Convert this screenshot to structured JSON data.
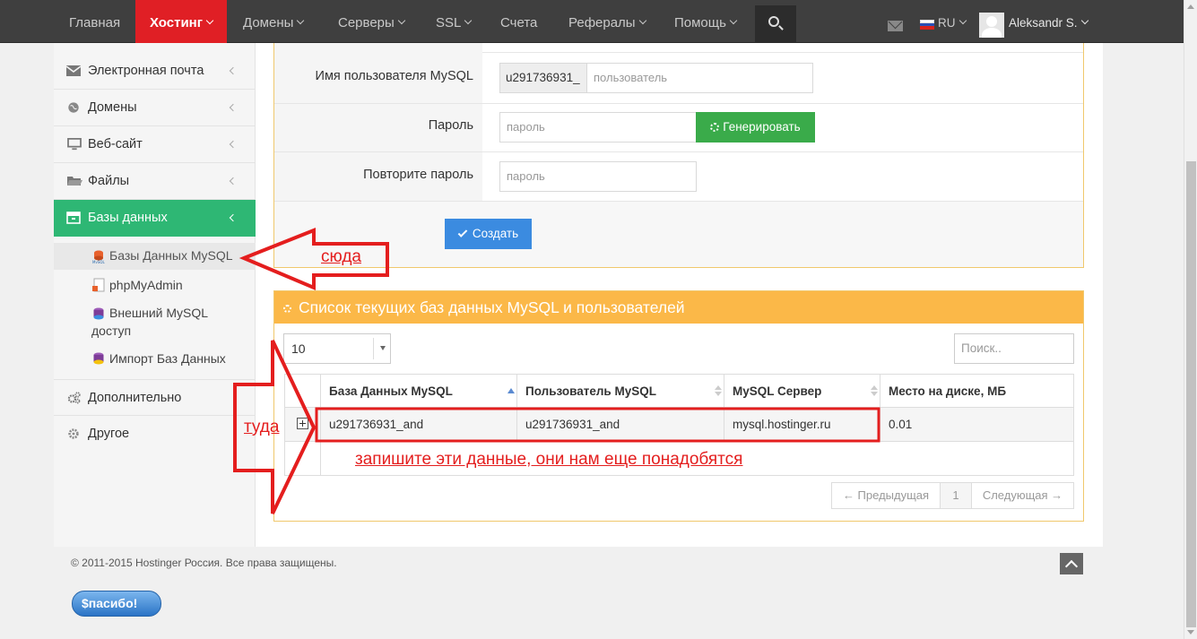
{
  "nav": {
    "items": [
      {
        "label": "Главная",
        "caret": false
      },
      {
        "label": "Хостинг",
        "caret": true
      },
      {
        "label": "Домены",
        "caret": true
      },
      {
        "label": "Серверы",
        "caret": true
      },
      {
        "label": "SSL",
        "caret": true
      },
      {
        "label": "Счета",
        "caret": false
      },
      {
        "label": "Рефералы",
        "caret": true
      },
      {
        "label": "Помощь",
        "caret": true
      }
    ],
    "active_item": "Хостинг",
    "language": "RU",
    "user_name": "Aleksandr S.",
    "accent_color": "#e01f25",
    "icons": [
      "search-icon",
      "mail-icon",
      "ru-flag-icon",
      "avatar-icon"
    ]
  },
  "sidebar": {
    "items": [
      {
        "label": "Электронная почта",
        "icon": "envelope-icon"
      },
      {
        "label": "Домены",
        "icon": "globe-icon"
      },
      {
        "label": "Веб-сайт",
        "icon": "monitor-icon"
      },
      {
        "label": "Файлы",
        "icon": "folder-icon"
      },
      {
        "label": "Базы данных",
        "icon": "database-icon"
      },
      {
        "label": "Дополнительно",
        "icon": "cogs-icon"
      },
      {
        "label": "Другое",
        "icon": "gear-icon"
      }
    ],
    "active_item": "Базы данных",
    "active_color": "#2eb774",
    "subitems": [
      {
        "label": "Базы Данных MySQL",
        "icon": "mysql-icon"
      },
      {
        "label": "phpMyAdmin",
        "icon": "phpmyadmin-icon"
      },
      {
        "label": "Внешний MySQL доступ",
        "label_line1": "Внешний MySQL",
        "label_line2": "доступ",
        "icon": "remote-db-icon"
      },
      {
        "label": "Импорт Баз Данных",
        "icon": "import-db-icon"
      }
    ],
    "active_subitem": "Базы Данных MySQL"
  },
  "form": {
    "username_label": "Имя пользователя MySQL",
    "username_prefix": "u291736931_",
    "username_placeholder": "пользователь",
    "password_label": "Пароль",
    "password_placeholder": "пароль",
    "generate_label": "Генерировать",
    "confirm_label": "Повторите пароль",
    "confirm_placeholder": "пароль",
    "create_label": "Создать"
  },
  "list": {
    "title": "Список текущих баз данных MySQL и пользователей",
    "page_size": "10",
    "search_placeholder": "Поиск..",
    "columns": [
      "База Данных MySQL",
      "Пользователь MySQL",
      "MySQL Сервер",
      "Место на диске, МБ"
    ],
    "rows": [
      [
        "u291736931_and",
        "u291736931_and",
        "mysql.hostinger.ru",
        "0.01"
      ]
    ],
    "pager": {
      "prev": "← Предыдущая",
      "page": "1",
      "next": "Следующая →"
    },
    "header_color": "#fbb848"
  },
  "footer": {
    "copyright": "© 2011-2015 Hostinger Россия. Все права защищены.",
    "badge": "$пасибо!"
  },
  "annotations": {
    "here": "сюда",
    "there": "туда",
    "note": "запишите эти данные, они нам еще понадобятся",
    "color": "#e41e1e"
  }
}
